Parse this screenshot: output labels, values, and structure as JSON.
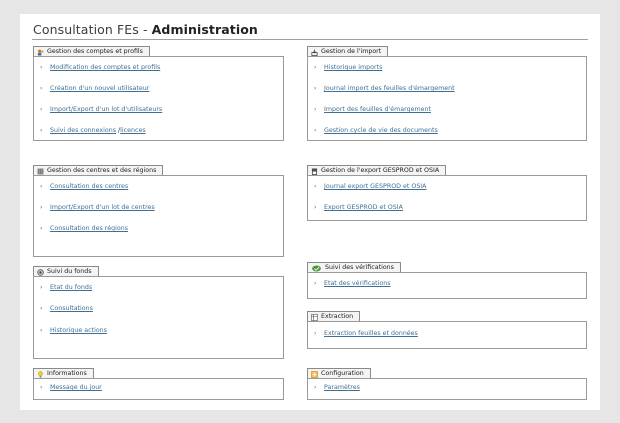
{
  "title": {
    "prefix": "Consultation FEs - ",
    "strong": "Administration"
  },
  "sections": {
    "comptes": {
      "title": "Gestion des comptes et profils",
      "icon": "users-icon",
      "items": [
        "Modification des comptes et profils",
        "Création d'un nouvel utilisateur",
        "Import/Export d'un lot d'utilisateurs"
      ],
      "last": {
        "a": "Suivi des connexions",
        "sep": " /",
        "b": "licences"
      }
    },
    "import": {
      "title": "Gestion de l'import",
      "icon": "import-icon",
      "items": [
        "Historique imports",
        "Journal import des feuilles d'émargement",
        "Import des feuilles d'émargement",
        "Gestion cycle de vie des documents"
      ]
    },
    "centres": {
      "title": "Gestion des centres et des régions",
      "icon": "building-icon",
      "items": [
        "Consultation des centres",
        "Import/Export d'un lot de centres",
        "Consultation des régions"
      ]
    },
    "export": {
      "title": "Gestion de l'export GESPROD et OSIA",
      "icon": "export-icon",
      "items": [
        "Journal export GESPROD et OSIA",
        "Export GESPROD et OSIA"
      ]
    },
    "fonds": {
      "title": "Suivi du fonds",
      "icon": "fund-icon",
      "items": [
        "Etat du fonds",
        "Consultations",
        "Historique actions"
      ]
    },
    "verif": {
      "title": "Suivi des vérifications",
      "icon": "check-icon",
      "items": [
        "Etat des vérifications"
      ]
    },
    "extraction": {
      "title": "Extraction",
      "icon": "extract-icon",
      "items": [
        "Extraction feuilles et données"
      ]
    },
    "info": {
      "title": "Informations",
      "icon": "lightbulb-icon",
      "items": [
        "Message du jour"
      ]
    },
    "config": {
      "title": "Configuration",
      "icon": "config-icon",
      "items": [
        "Paramètres"
      ]
    }
  },
  "bullet": "›"
}
